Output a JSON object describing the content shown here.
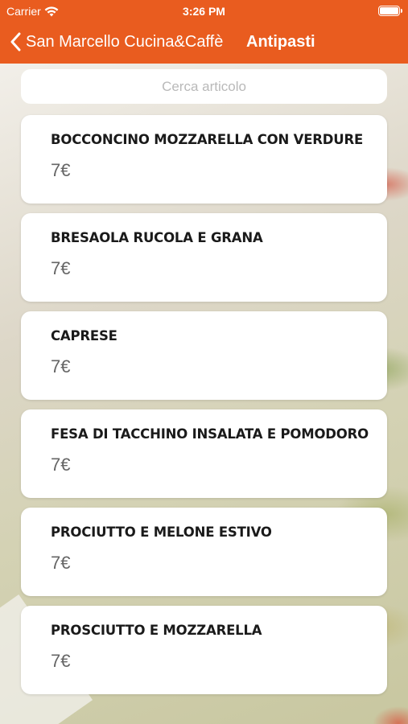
{
  "status_bar": {
    "carrier": "Carrier",
    "time": "3:26 PM"
  },
  "nav": {
    "back_label": "San Marcello Cucina&Caffè",
    "title": "Antipasti"
  },
  "search": {
    "placeholder": "Cerca articolo",
    "value": ""
  },
  "items": [
    {
      "name": "BOCCONCINO MOZZARELLA CON VERDURE",
      "price": "7€"
    },
    {
      "name": "BRESAOLA RUCOLA E GRANA",
      "price": "7€"
    },
    {
      "name": "CAPRESE",
      "price": "7€"
    },
    {
      "name": "FESA DI TACCHINO INSALATA E POMODORO",
      "price": "7€"
    },
    {
      "name": "PROCIUTTO E MELONE ESTIVO",
      "price": "7€"
    },
    {
      "name": "PROSCIUTTO E MOZZARELLA",
      "price": "7€"
    }
  ],
  "colors": {
    "header": "#e95c1f",
    "card": "#ffffff",
    "price_text": "#666666"
  },
  "icons": {
    "wifi": "wifi-icon",
    "battery": "battery-icon",
    "back": "chevron-left-icon"
  }
}
